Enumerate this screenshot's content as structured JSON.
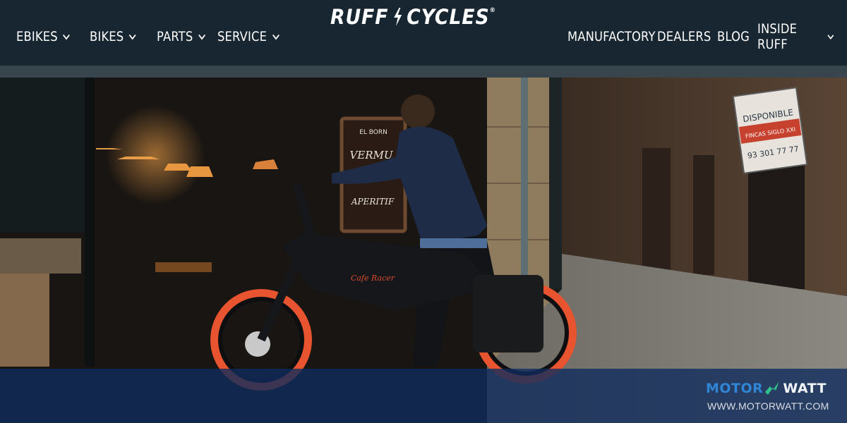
{
  "brand": {
    "logo_left": "RUFF",
    "logo_right": "CYCLES",
    "logo_mark": "®"
  },
  "nav": {
    "left": [
      {
        "label": "EBIKES",
        "icon": "chevron-down-icon"
      },
      {
        "label": "BIKES",
        "icon": "chevron-down-icon"
      },
      {
        "label": "PARTS",
        "icon": "chevron-down-icon"
      },
      {
        "label": "SERVICE",
        "icon": "chevron-down-icon"
      }
    ],
    "right": [
      {
        "label": "MANUFACTORY"
      },
      {
        "label": "DEALERS"
      },
      {
        "label": "BLOG"
      },
      {
        "label": "INSIDE RUFF",
        "icon": "chevron-down-icon"
      }
    ]
  },
  "hero": {
    "sign_line1": "DISPONIBLE",
    "sign_line2": "FINCAS SIGLO XXI",
    "sign_phone": "93 301 77 77",
    "chalkboard_top": "EL BORN",
    "chalkboard_mid": "VERMU",
    "chalkboard_bottom": "APERITIF",
    "bike_badge": "Cafe Racer"
  },
  "watermark": {
    "brand_left": "MOTOR",
    "brand_right": "WATT",
    "url": "WWW.MOTORWATT.COM"
  },
  "colors": {
    "nav_bg": "#172630",
    "tire": "#e8542f",
    "watermark_blue": "#2f86d6",
    "watermark_bolt": "#2fc48a",
    "band": "#102c5c"
  }
}
